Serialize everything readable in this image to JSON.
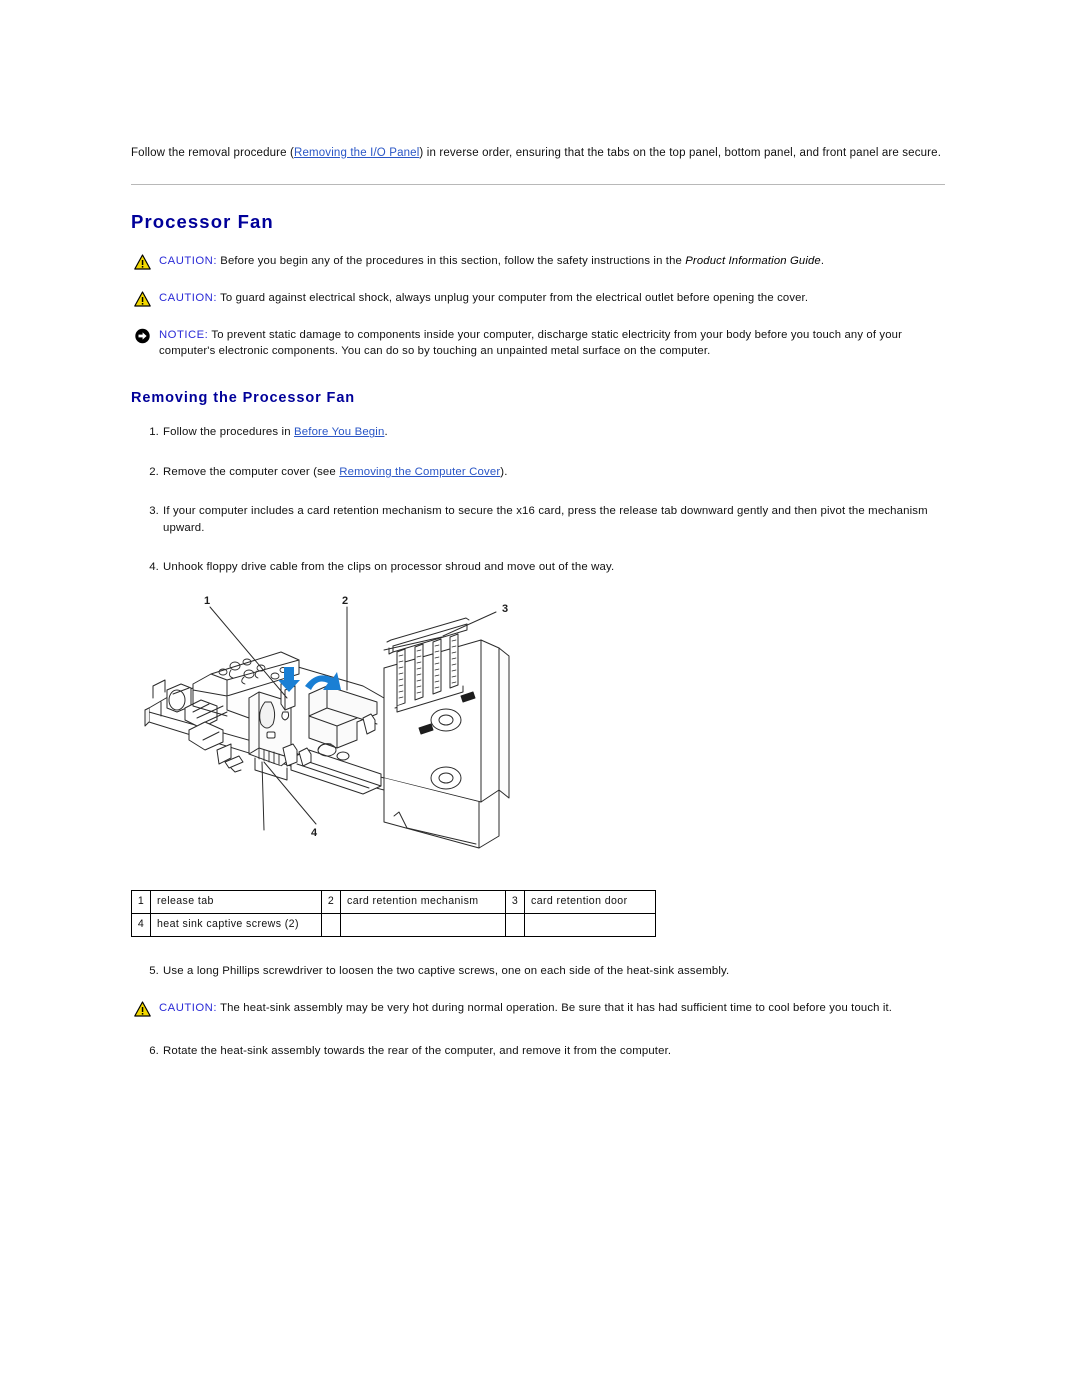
{
  "intro": {
    "before_link": "Follow the removal procedure (",
    "link_text": "Removing the I/O Panel",
    "after_link": ") in reverse order, ensuring that the tabs on the top panel, bottom panel, and front panel are secure."
  },
  "section": {
    "title": "Processor Fan",
    "subtitle": "Removing the Processor Fan"
  },
  "admonitions": {
    "caution1": {
      "keyword": "CAUTION:",
      "text_before_italic": " Before you begin any of the procedures in this section, follow the safety instructions in the ",
      "italic_text": "Product Information Guide",
      "text_after_italic": ".",
      "icon": "warning-triangle-icon"
    },
    "caution2": {
      "keyword": "CAUTION:",
      "text": " To guard against electrical shock, always unplug your computer from the electrical outlet before opening the cover.",
      "icon": "warning-triangle-icon"
    },
    "notice1": {
      "keyword": "NOTICE:",
      "text": " To prevent static damage to components inside your computer, discharge static electricity from your body before you touch any of your computer's electronic components. You can do so by touching an unpainted metal surface on the computer.",
      "icon": "notice-circle-icon"
    },
    "caution3": {
      "keyword": "CAUTION:",
      "text": " The heat-sink assembly may be very hot during normal operation. Be sure that it has had sufficient time to cool before you touch it.",
      "icon": "warning-triangle-icon"
    }
  },
  "steps": [
    {
      "number": "1.",
      "text_before_link": "Follow the procedures in ",
      "link_text": "Before You Begin",
      "text_after_link": "."
    },
    {
      "number": "2.",
      "text_before_link": "Remove the computer cover (see ",
      "link_text": "Removing the Computer Cover",
      "text_after_link": ")."
    },
    {
      "number": "3.",
      "text": "If your computer includes a card retention mechanism to secure the x16 card, press the release tab downward gently and then pivot the mechanism upward."
    },
    {
      "number": "4.",
      "text": "Unhook floppy drive cable from the clips on processor shroud and move out of the way."
    }
  ],
  "tail_steps": [
    {
      "number": "5.",
      "text": "Use a long Phillips screwdriver to loosen the two captive screws, one on each side of the heat-sink assembly."
    },
    {
      "number": "6.",
      "text": "Rotate the heat-sink assembly towards the rear of the computer, and remove it from the computer."
    }
  ],
  "figure": {
    "callouts": [
      "1",
      "2",
      "3",
      "4"
    ],
    "arrow_color": "#1a7fd4",
    "line_color": "#2b2b2b"
  },
  "legend": {
    "rows": [
      [
        {
          "num": "1",
          "label": "release tab"
        },
        {
          "num": "2",
          "label": "card retention mechanism"
        },
        {
          "num": "3",
          "label": "card retention door"
        }
      ],
      [
        {
          "num": "4",
          "label": "heat sink captive screws (2)"
        },
        {
          "num": "",
          "label": ""
        },
        {
          "num": "",
          "label": ""
        }
      ]
    ]
  },
  "colors": {
    "heading_blue": "#000099",
    "link_blue": "#2a56c6",
    "keyword_blue": "#2a2ad6",
    "caution_yellow": "#f2d800",
    "rule_gray": "#b8b8b8"
  }
}
